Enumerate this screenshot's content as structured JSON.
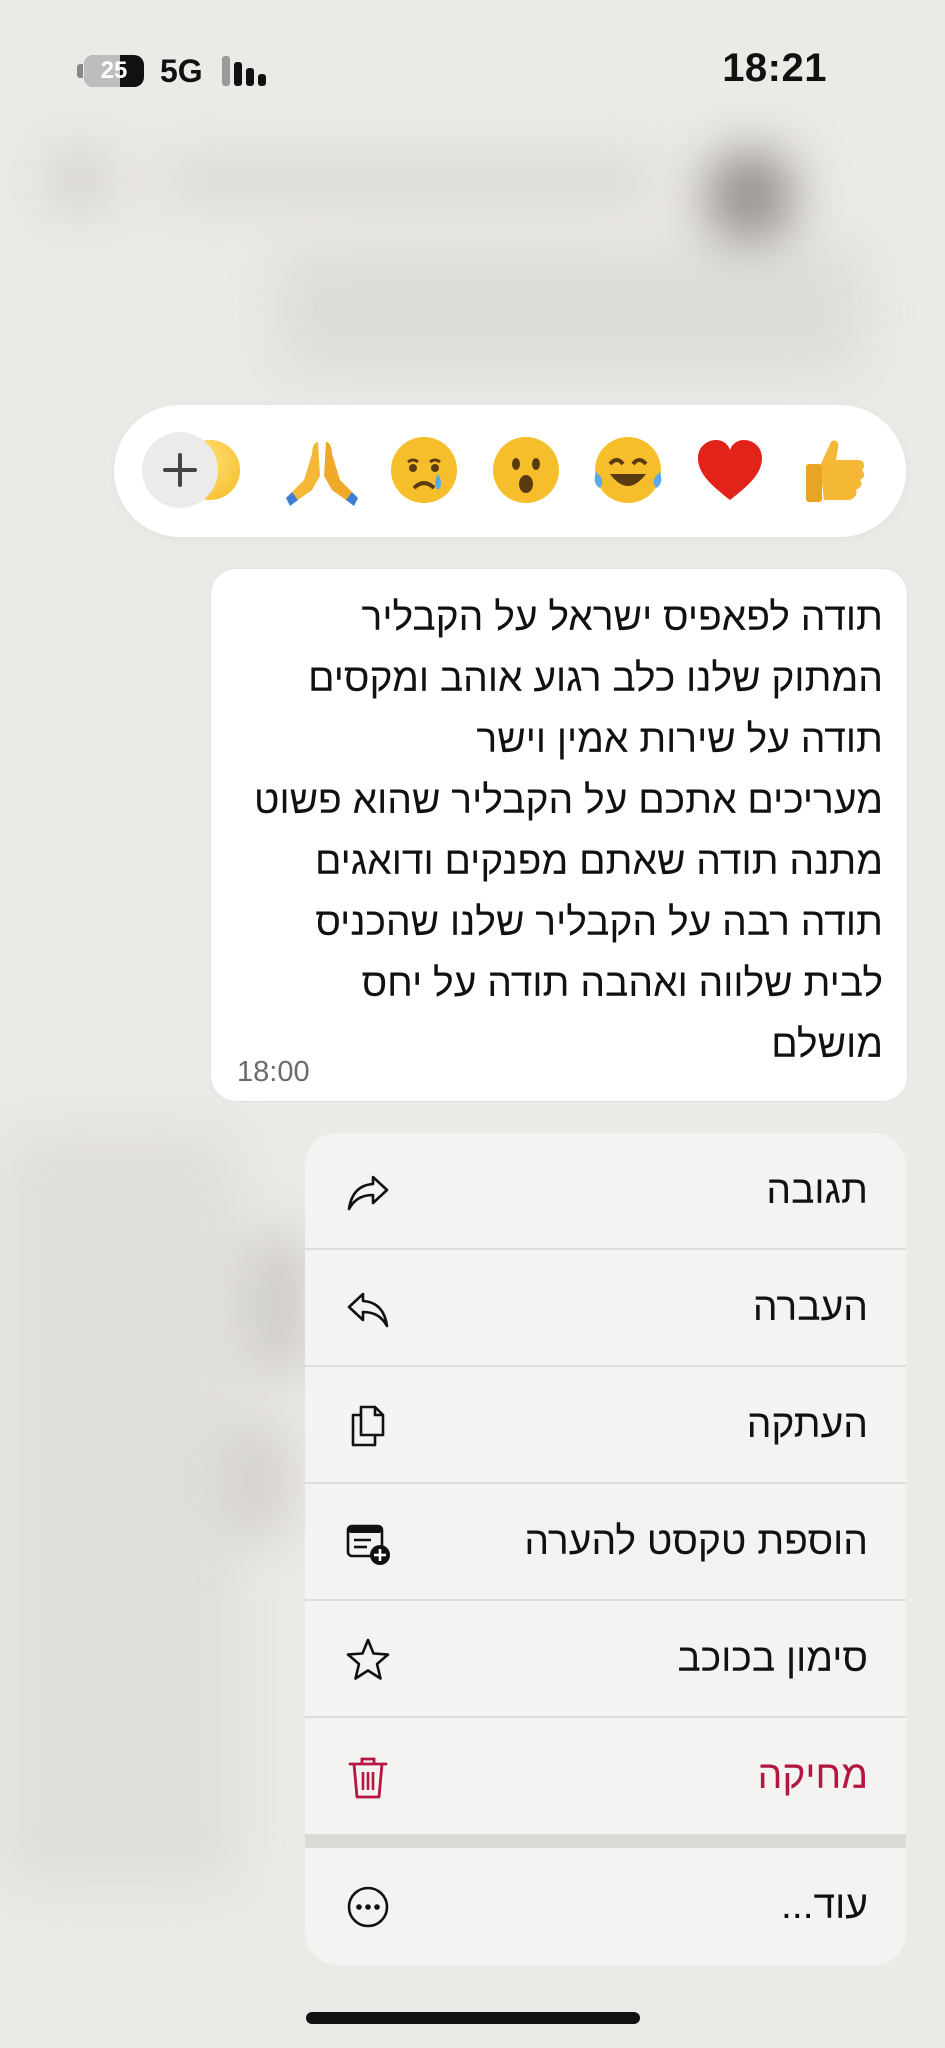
{
  "status_bar": {
    "battery_level": "25",
    "network": "5G",
    "time": "18:21"
  },
  "reactions": {
    "emojis": [
      "🙏",
      "😢",
      "😮",
      "😂",
      "❤️",
      "👍"
    ],
    "add_icon": "plus-icon"
  },
  "message": {
    "lines": [
      "תודה לפאפיס ישראל על הקבליר",
      "המתוק שלנו כלב רגוע אוהב ומקסים",
      "תודה על שירות אמין וישר",
      "מעריכים אתכם על הקבליר שהוא פשוט",
      "מתנה תודה שאתם מפנקים ודואגים",
      "תודה רבה על הקבליר שלנו שהכניס",
      "לבית שלווה ואהבה תודה על יחס",
      "מושלם"
    ],
    "time": "18:00"
  },
  "menu": {
    "items": [
      {
        "label": "תגובה",
        "icon": "reply-arrow-icon"
      },
      {
        "label": "העברה",
        "icon": "forward-arrow-icon"
      },
      {
        "label": "העתקה",
        "icon": "copy-icon"
      },
      {
        "label": "הוספת טקסט להערה",
        "icon": "add-note-icon"
      },
      {
        "label": "סימון בכוכב",
        "icon": "star-icon"
      },
      {
        "label": "מחיקה",
        "icon": "trash-icon"
      },
      {
        "label": "עוד...",
        "icon": "more-icon"
      }
    ],
    "danger_color": "#B3163E"
  }
}
